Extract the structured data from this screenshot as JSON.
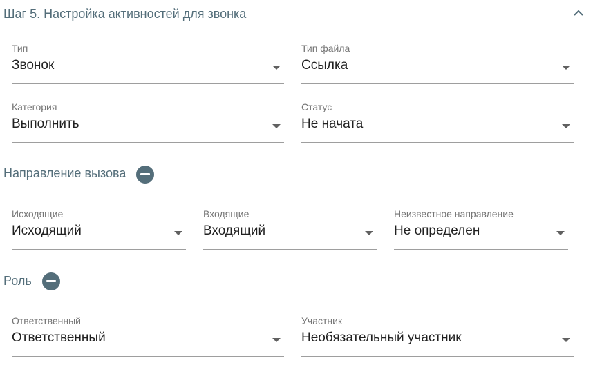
{
  "step_title": "Шаг 5. Настройка активностей для звонка",
  "colors": {
    "accent": "#546e7a",
    "underline": "#9e9e9e"
  },
  "fields": {
    "type": {
      "label": "Тип",
      "value": "Звонок"
    },
    "file_type": {
      "label": "Тип файла",
      "value": "Ссылка"
    },
    "category": {
      "label": "Категория",
      "value": "Выполнить"
    },
    "status": {
      "label": "Статус",
      "value": "Не начата"
    }
  },
  "call_direction": {
    "title": "Направление вызова",
    "outgoing": {
      "label": "Исходящие",
      "value": "Исходящий"
    },
    "incoming": {
      "label": "Входящие",
      "value": "Входящий"
    },
    "unknown": {
      "label": "Неизвестное направление",
      "value": "Не определен"
    }
  },
  "role": {
    "title": "Роль",
    "responsible": {
      "label": "Ответственный",
      "value": "Ответственный"
    },
    "participant": {
      "label": "Участник",
      "value": "Необязательный участник"
    }
  },
  "icons": {
    "collapse": "chevron-up-icon",
    "remove": "minus-circle-icon",
    "dropdown": "caret-down-icon"
  }
}
